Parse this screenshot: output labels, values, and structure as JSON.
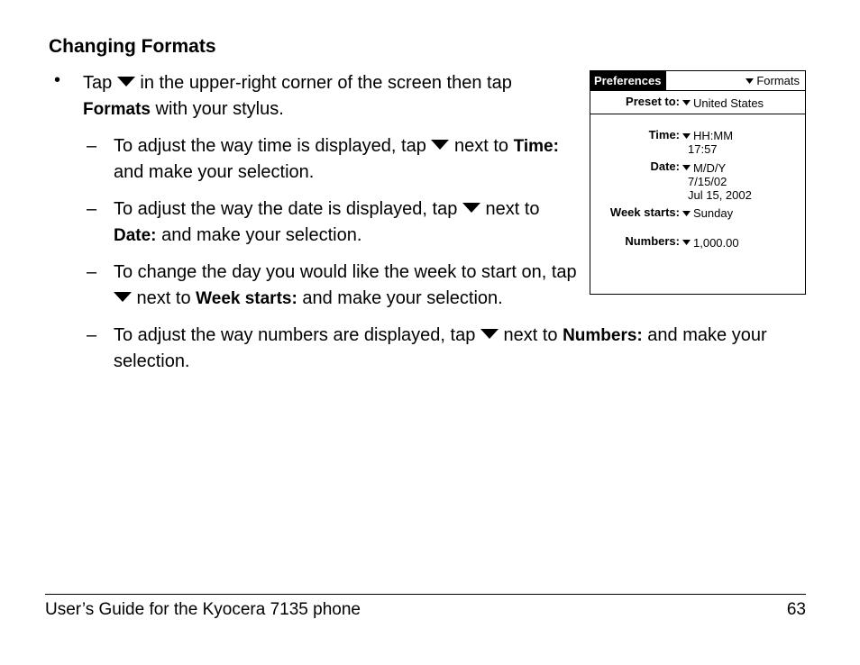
{
  "heading": "Changing Formats",
  "bullet": {
    "pre": "Tap ",
    "mid": " in the upper-right corner of the screen then tap ",
    "formats_word": "Formats",
    "post": " with your stylus."
  },
  "subs": {
    "time": {
      "pre": "To adjust the way time is displayed, tap ",
      "mid": " next to ",
      "label": "Time:",
      "post": " and make your selection."
    },
    "date": {
      "pre": "To adjust the way the date is displayed, tap ",
      "mid": " next to ",
      "label": "Date:",
      "post": " and make your selection."
    },
    "week": {
      "pre": "To change the day you would like the week to start on, tap ",
      "mid": " next to ",
      "label": "Week starts:",
      "post": " and make your selection."
    },
    "numbers": {
      "pre": "To adjust the way numbers are displayed, tap ",
      "mid": " next to ",
      "label": "Numbers:",
      "post": " and make your selection."
    }
  },
  "screenshot": {
    "title": "Preferences",
    "menu": "Formats",
    "preset_label": "Preset to:",
    "preset_value": "United States",
    "time_label": "Time:",
    "time_value": "HH:MM",
    "time_example": "17:57",
    "date_label": "Date:",
    "date_value": "M/D/Y",
    "date_example1": "7/15/02",
    "date_example2": "Jul 15, 2002",
    "week_label": "Week starts:",
    "week_value": "Sunday",
    "numbers_label": "Numbers:",
    "numbers_value": "1,000.00"
  },
  "footer": {
    "left": "User’s Guide for the Kyocera 7135 phone",
    "right": "63"
  }
}
